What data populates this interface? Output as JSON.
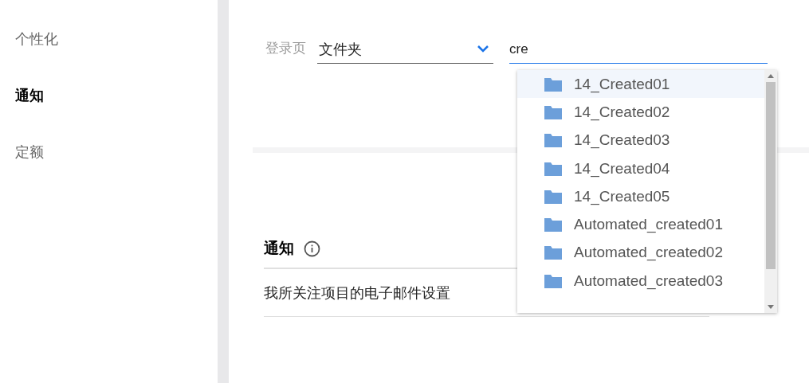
{
  "sidebar": {
    "items": [
      {
        "label": "个性化",
        "selected": false
      },
      {
        "label": "通知",
        "selected": true
      },
      {
        "label": "定额",
        "selected": false
      }
    ]
  },
  "landing": {
    "label": "登录页",
    "select_value": "文件夹",
    "search_value": "cre"
  },
  "dropdown": {
    "items": [
      {
        "label": "14_Created01",
        "selected": true
      },
      {
        "label": "14_Created02",
        "selected": false
      },
      {
        "label": "14_Created03",
        "selected": false
      },
      {
        "label": "14_Created04",
        "selected": false
      },
      {
        "label": "14_Created05",
        "selected": false
      },
      {
        "label": "Automated_created01",
        "selected": false
      },
      {
        "label": "Automated_created02",
        "selected": false
      },
      {
        "label": "Automated_created03",
        "selected": false
      }
    ]
  },
  "notifications": {
    "title": "通知",
    "rows": [
      {
        "label": "我所关注项目的电子邮件设置"
      }
    ]
  }
}
